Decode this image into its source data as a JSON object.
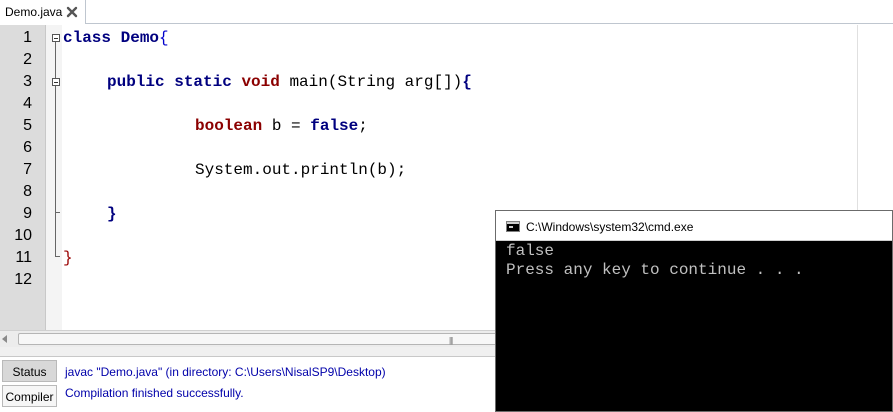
{
  "editor": {
    "tab": {
      "label": "Demo.java",
      "close_icon": "close-x-icon"
    },
    "line_numbers": [
      "1",
      "2",
      "3",
      "4",
      "5",
      "6",
      "7",
      "8",
      "9",
      "10",
      "11",
      "12"
    ],
    "code": {
      "l1": {
        "kw": "class",
        "name": "Demo",
        "brace": "{"
      },
      "l3": {
        "kw1": "public",
        "kw2": "static",
        "kw3": "void",
        "sig": " main(String arg[])",
        "brace": "{"
      },
      "l5": {
        "type": "boolean",
        "mid": " b = ",
        "val": "false",
        "end": ";"
      },
      "l7": {
        "text": "System.out.println(b);"
      },
      "l9": {
        "brace": "}"
      },
      "l11": {
        "brace": "}"
      }
    },
    "colors": {
      "keyword": "#00007f",
      "type_keyword": "#8b0000"
    }
  },
  "output_panel": {
    "tabs": [
      "Status",
      "Compiler"
    ],
    "active_tab": "Status",
    "lines": [
      "javac \"Demo.java\" (in directory: C:\\Users\\NisalSP9\\Desktop)",
      "Compilation finished successfully."
    ]
  },
  "cmd_window": {
    "title": "C:\\Windows\\system32\\cmd.exe",
    "icon": "console-icon",
    "output": [
      "false",
      "Press any key to continue . . ."
    ]
  }
}
